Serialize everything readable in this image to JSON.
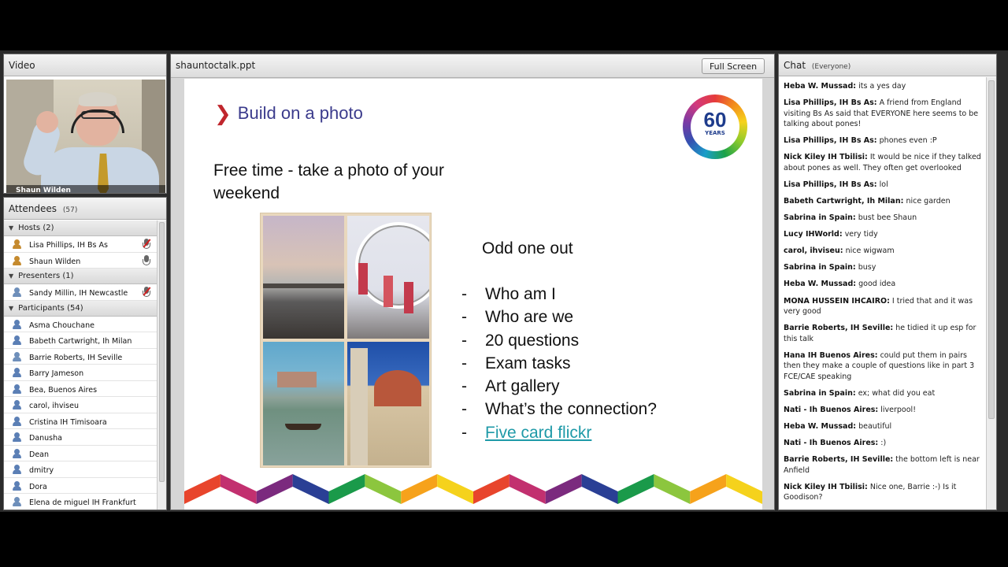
{
  "video": {
    "title": "Video",
    "presenter_name": "Shaun Wilden"
  },
  "attendees": {
    "title": "Attendees",
    "count": "(57)",
    "groups": [
      {
        "label": "Hosts (2)",
        "people": [
          {
            "name": "Lisa Phillips, IH Bs As",
            "role": "host",
            "mic": "muted"
          },
          {
            "name": "Shaun Wilden",
            "role": "host",
            "mic": "active"
          }
        ]
      },
      {
        "label": "Presenters (1)",
        "people": [
          {
            "name": "Sandy Millin, IH Newcastle",
            "role": "presenter",
            "mic": "muted"
          }
        ]
      },
      {
        "label": "Participants (54)",
        "people": [
          {
            "name": "Asma Chouchane",
            "role": "participant"
          },
          {
            "name": "Babeth Cartwright, Ih Milan",
            "role": "participant"
          },
          {
            "name": "Barrie Roberts, IH Seville",
            "role": "presenter-icon"
          },
          {
            "name": "Barry Jameson",
            "role": "participant"
          },
          {
            "name": "Bea, Buenos Aires",
            "role": "participant"
          },
          {
            "name": "carol, ihviseu",
            "role": "participant"
          },
          {
            "name": "Cristina IH Timisoara",
            "role": "participant"
          },
          {
            "name": "Danusha",
            "role": "participant"
          },
          {
            "name": "Dean",
            "role": "participant"
          },
          {
            "name": "dmitry",
            "role": "participant"
          },
          {
            "name": "Dora",
            "role": "participant"
          },
          {
            "name": "Elena de miguel IH Frankfurt",
            "role": "presenter-icon"
          }
        ]
      }
    ]
  },
  "share": {
    "title": "shauntoctalk.ppt",
    "fullscreen_label": "Full Screen",
    "slide": {
      "chevron": "❯",
      "title": "Build on a photo",
      "badge_number": "60",
      "badge_word": "YEARS",
      "heading": "Free time - take a photo of your weekend",
      "odd_title": "Odd one out",
      "items": [
        {
          "dash": "-",
          "text": "Who am I"
        },
        {
          "dash": "-",
          "text": "Who are we"
        },
        {
          "dash": "-",
          "text": "20 questions"
        },
        {
          "dash": "-",
          "text": "Exam tasks"
        },
        {
          "dash": "-",
          "text": "Art gallery"
        },
        {
          "dash": "-",
          "text": "What’s the connection?"
        },
        {
          "dash": "-",
          "text": "Five card flickr",
          "link": true
        }
      ],
      "zigzag_colors": [
        "#e8452c",
        "#c2306f",
        "#7b2a7e",
        "#2a3f95",
        "#1a9a4a",
        "#8cc63e",
        "#f6a21b",
        "#f5d21c"
      ]
    }
  },
  "chat": {
    "title": "Chat",
    "scope": "(Everyone)",
    "messages": [
      {
        "who": "Heba W. Mussad:",
        "text": "its a yes day"
      },
      {
        "who": "Lisa Phillips, IH Bs As:",
        "text": "A friend from England visiting Bs As said that EVERYONE here seems to be talking about pones!"
      },
      {
        "who": "Lisa Phillips, IH Bs As:",
        "text": "phones even :P"
      },
      {
        "who": "Nick Kiley IH Tbilisi:",
        "text": "It would be nice if they talked about pones as well. They often get overlooked"
      },
      {
        "who": "Lisa Phillips, IH Bs As:",
        "text": "lol"
      },
      {
        "who": "Babeth Cartwright, Ih Milan:",
        "text": "nice garden"
      },
      {
        "who": "Sabrina in Spain:",
        "text": "bust bee Shaun"
      },
      {
        "who": "Lucy IHWorld:",
        "text": "very tidy"
      },
      {
        "who": "carol, ihviseu:",
        "text": "nice wigwam"
      },
      {
        "who": "Sabrina in Spain:",
        "text": "busy"
      },
      {
        "who": "Heba W. Mussad:",
        "text": "good idea"
      },
      {
        "who": "MONA HUSSEIN IHCAIRO:",
        "text": "I tried that and it was very good"
      },
      {
        "who": "Barrie Roberts, IH Seville:",
        "text": "he tidied it up esp for this talk"
      },
      {
        "who": "Hana IH Buenos Aires:",
        "text": "could put them in pairs then they make a couple of questions like in part 3 FCE/CAE speaking"
      },
      {
        "who": "Sabrina in Spain:",
        "text": "ex; what did you eat"
      },
      {
        "who": "Nati - Ih Buenos Aires:",
        "text": "liverpool!"
      },
      {
        "who": "Heba W. Mussad:",
        "text": "beautiful"
      },
      {
        "who": "Nati - Ih Buenos Aires:",
        "text": ":)"
      },
      {
        "who": "Barrie Roberts, IH Seville:",
        "text": "the bottom left is near Anfield"
      },
      {
        "who": "Nick Kiley IH Tbilisi:",
        "text": "Nice one, Barrie :-) Is it Goodison?"
      }
    ]
  }
}
